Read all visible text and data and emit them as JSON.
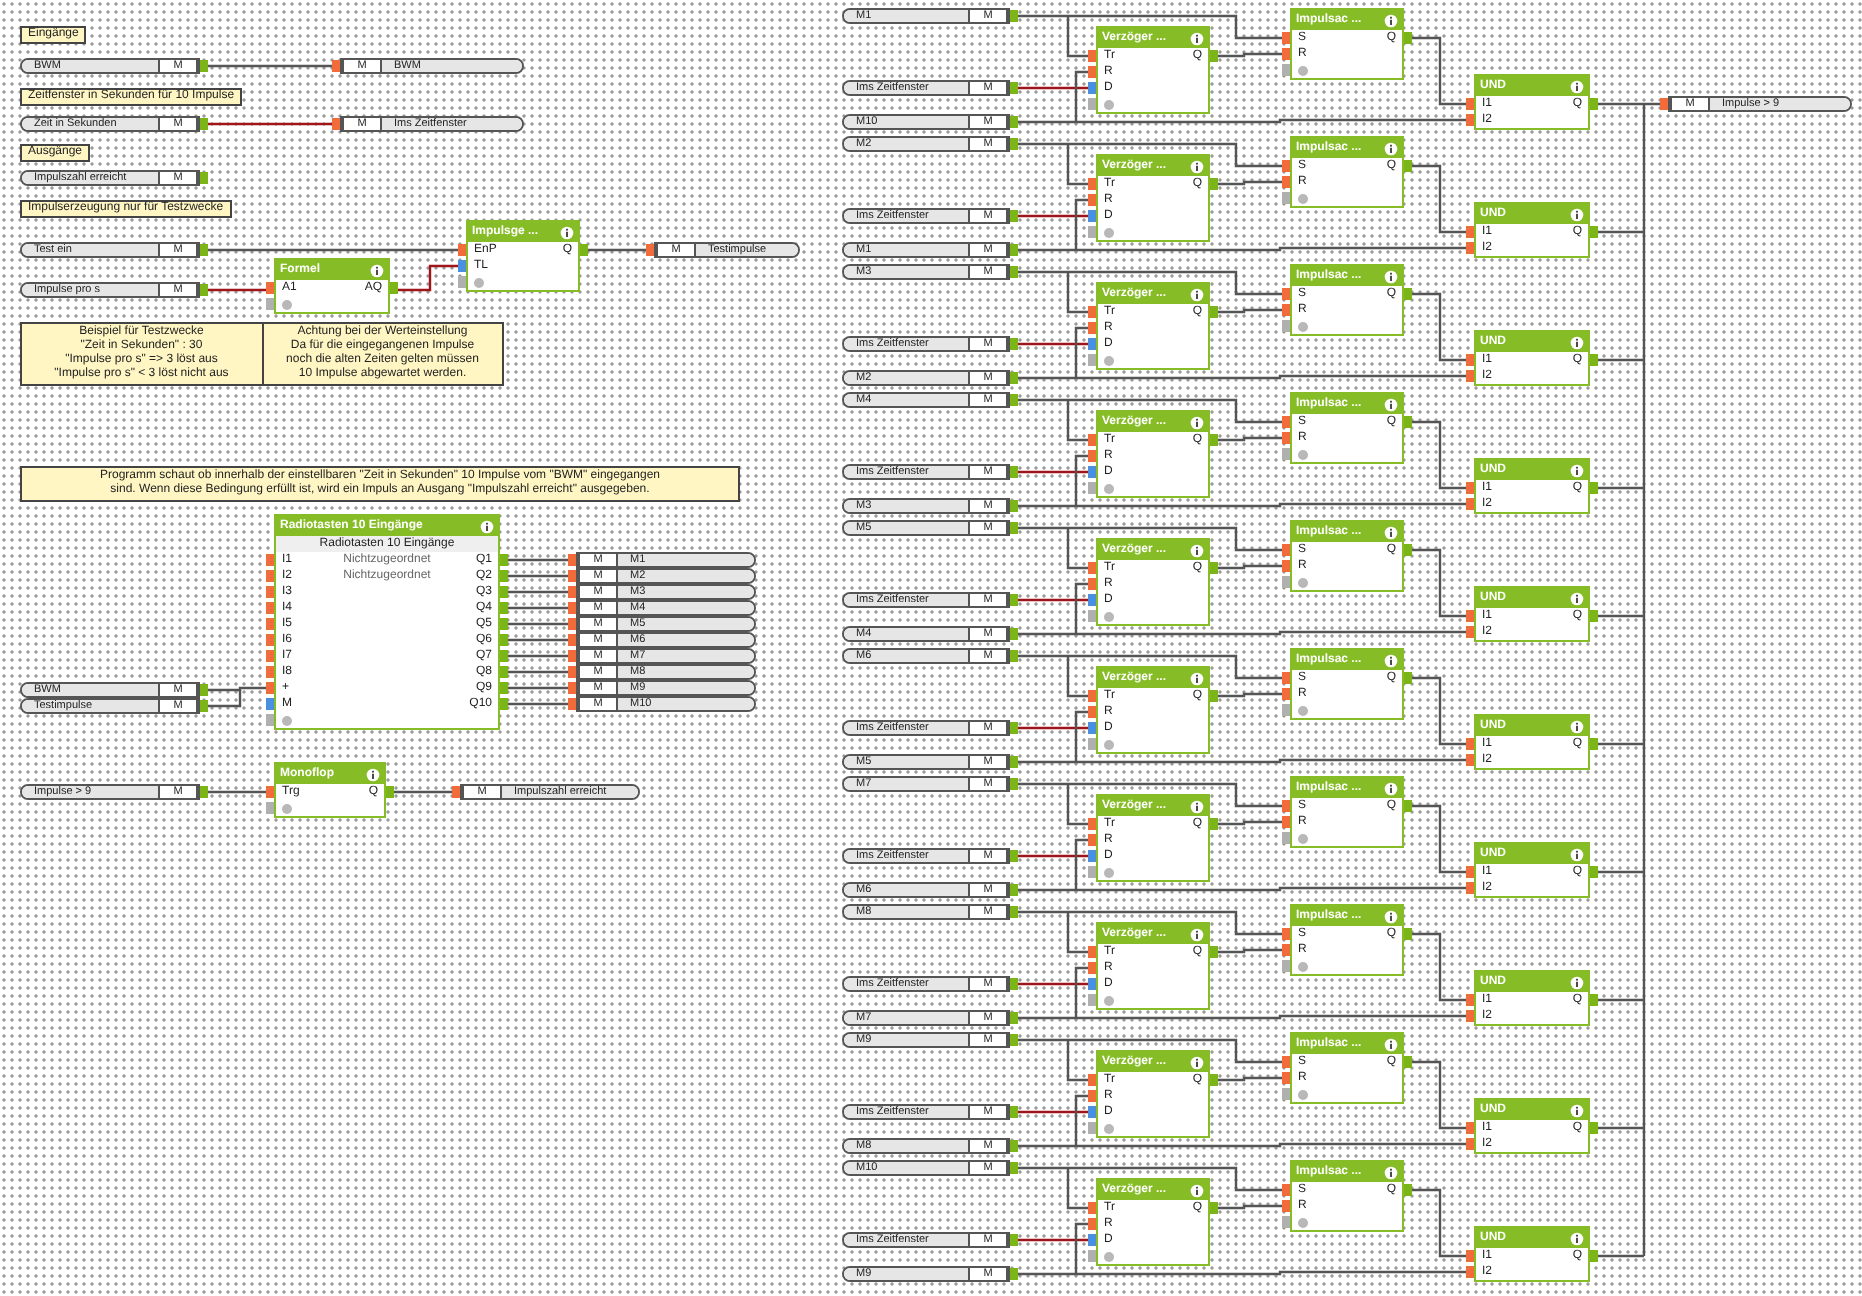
{
  "labels": [
    "Eingänge",
    "Zeitfenster in Sekunden für 10 Impulse",
    "Ausgänge",
    "Impulserzeugung nur für Testzwecke"
  ],
  "refs": [
    {
      "kind": "input",
      "name": "BWM",
      "tag": "M"
    },
    {
      "kind": "output",
      "name": "BWM",
      "tag": "M"
    },
    {
      "kind": "input",
      "name": "Zeit in Sekunden",
      "tag": "M"
    },
    {
      "kind": "output",
      "name": "Ims Zeitfenster",
      "tag": "M"
    },
    {
      "kind": "input",
      "name": "Impulszahl erreicht",
      "tag": "M"
    },
    {
      "kind": "input",
      "name": "Test ein",
      "tag": "M"
    },
    {
      "kind": "input",
      "name": "Impulse pro s",
      "tag": "M"
    },
    {
      "kind": "output",
      "name": "Testimpulse",
      "tag": "M"
    },
    {
      "kind": "input",
      "name": "BWM",
      "tag": "M"
    },
    {
      "kind": "input",
      "name": "Testimpulse",
      "tag": "M"
    },
    {
      "kind": "output",
      "name": "M1",
      "tag": "M"
    },
    {
      "kind": "output",
      "name": "M2",
      "tag": "M"
    },
    {
      "kind": "output",
      "name": "M3",
      "tag": "M"
    },
    {
      "kind": "output",
      "name": "M4",
      "tag": "M"
    },
    {
      "kind": "output",
      "name": "M5",
      "tag": "M"
    },
    {
      "kind": "output",
      "name": "M6",
      "tag": "M"
    },
    {
      "kind": "output",
      "name": "M7",
      "tag": "M"
    },
    {
      "kind": "output",
      "name": "M8",
      "tag": "M"
    },
    {
      "kind": "output",
      "name": "M9",
      "tag": "M"
    },
    {
      "kind": "output",
      "name": "M10",
      "tag": "M"
    },
    {
      "kind": "input",
      "name": "Impulse > 9",
      "tag": "M"
    },
    {
      "kind": "output",
      "name": "Impulszahl erreicht",
      "tag": "M"
    }
  ],
  "blocks": [
    {
      "status_row": true,
      "title": "Formel",
      "inputs": [
        {
          "label": "A1",
          "kind": "binary"
        }
      ],
      "outputs": [
        "AQ"
      ]
    },
    {
      "status_row": true,
      "title": "Impulsge ...",
      "inputs": [
        {
          "label": "EnP",
          "kind": "binary"
        },
        {
          "label": "TL",
          "kind": "value"
        }
      ],
      "outputs": [
        "Q"
      ]
    },
    {
      "status_row": true,
      "title": "Radiotasten 10 Eingänge",
      "subtitle": "Radiotasten 10 Eingänge",
      "notes": [
        "Nichtzugeordnet",
        "Nichtzugeordnet"
      ],
      "inputs": [
        {
          "label": "I1",
          "kind": "binary"
        },
        {
          "label": "I2",
          "kind": "binary"
        },
        {
          "label": "I3",
          "kind": "binary"
        },
        {
          "label": "I4",
          "kind": "binary"
        },
        {
          "label": "I5",
          "kind": "binary"
        },
        {
          "label": "I6",
          "kind": "binary"
        },
        {
          "label": "I7",
          "kind": "binary"
        },
        {
          "label": "I8",
          "kind": "binary"
        },
        {
          "label": "+",
          "kind": "binary"
        },
        {
          "label": "M",
          "kind": "value"
        }
      ],
      "outputs": [
        "Q1",
        "Q2",
        "Q3",
        "Q4",
        "Q5",
        "Q6",
        "Q7",
        "Q8",
        "Q9",
        "Q10"
      ]
    },
    {
      "status_row": true,
      "title": "Monoflop",
      "inputs": [
        {
          "label": "Trg",
          "kind": "binary"
        }
      ],
      "outputs": [
        "Q"
      ]
    }
  ],
  "notes": [
    {
      "columns": [
        [
          "Beispiel für Testzwecke",
          "\"Zeit in Sekunden\" : 30",
          "\"Impulse pro s\" => 3 löst aus",
          "\"Impulse pro s\" < 3 löst nicht aus"
        ],
        [
          "Achtung bei der Werteinstellung",
          "Da für die eingegangenen Impulse",
          "noch die alten Zeiten gelten müssen",
          "10 Impulse abgewartet werden."
        ]
      ]
    },
    {
      "columns": [
        [
          "Programm schaut ob innerhalb der einstellbaren \"Zeit in Sekunden\" 10 Impulse vom \"BWM\" eingegangen",
          "sind. Wenn diese Bedingung erfüllt ist, wird ein Impuls an Ausgang \"Impulszahl erreicht\" ausgegeben."
        ]
      ]
    }
  ],
  "chains": [
    {
      "trigger": {
        "kind": "input",
        "name": "M1",
        "tag": "M"
      },
      "window": {
        "kind": "input",
        "name": "Ims Zeitfenster",
        "tag": "M"
      },
      "reset": {
        "kind": "input",
        "name": "M10",
        "tag": "M"
      },
      "delay": {
        "status_row": true,
        "title": "Verzöger ...",
        "inputs": [
          {
            "label": "Tr",
            "kind": "binary"
          },
          {
            "label": "R",
            "kind": "binary"
          },
          {
            "label": "D",
            "kind": "value"
          }
        ],
        "outputs": [
          "Q"
        ]
      },
      "pulse": {
        "status_row": true,
        "title": "Impulsac ...",
        "inputs": [
          {
            "label": "S",
            "kind": "binary"
          },
          {
            "label": "R",
            "kind": "binary"
          }
        ],
        "outputs": [
          "Q"
        ]
      },
      "and": {
        "title": "UND",
        "inputs": [
          {
            "label": "I1",
            "kind": "binary"
          },
          {
            "label": "I2",
            "kind": "binary"
          }
        ],
        "outputs": [
          "Q"
        ]
      }
    },
    {
      "trigger": {
        "kind": "input",
        "name": "M2",
        "tag": "M"
      },
      "window": {
        "kind": "input",
        "name": "Ims Zeitfenster",
        "tag": "M"
      },
      "reset": {
        "kind": "input",
        "name": "M1",
        "tag": "M"
      },
      "delay": {
        "status_row": true,
        "title": "Verzöger ...",
        "inputs": [
          {
            "label": "Tr",
            "kind": "binary"
          },
          {
            "label": "R",
            "kind": "binary"
          },
          {
            "label": "D",
            "kind": "value"
          }
        ],
        "outputs": [
          "Q"
        ]
      },
      "pulse": {
        "status_row": true,
        "title": "Impulsac ...",
        "inputs": [
          {
            "label": "S",
            "kind": "binary"
          },
          {
            "label": "R",
            "kind": "binary"
          }
        ],
        "outputs": [
          "Q"
        ]
      },
      "and": {
        "title": "UND",
        "inputs": [
          {
            "label": "I1",
            "kind": "binary"
          },
          {
            "label": "I2",
            "kind": "binary"
          }
        ],
        "outputs": [
          "Q"
        ]
      }
    },
    {
      "trigger": {
        "kind": "input",
        "name": "M3",
        "tag": "M"
      },
      "window": {
        "kind": "input",
        "name": "Ims Zeitfenster",
        "tag": "M"
      },
      "reset": {
        "kind": "input",
        "name": "M2",
        "tag": "M"
      },
      "delay": {
        "status_row": true,
        "title": "Verzöger ...",
        "inputs": [
          {
            "label": "Tr",
            "kind": "binary"
          },
          {
            "label": "R",
            "kind": "binary"
          },
          {
            "label": "D",
            "kind": "value"
          }
        ],
        "outputs": [
          "Q"
        ]
      },
      "pulse": {
        "status_row": true,
        "title": "Impulsac ...",
        "inputs": [
          {
            "label": "S",
            "kind": "binary"
          },
          {
            "label": "R",
            "kind": "binary"
          }
        ],
        "outputs": [
          "Q"
        ]
      },
      "and": {
        "title": "UND",
        "inputs": [
          {
            "label": "I1",
            "kind": "binary"
          },
          {
            "label": "I2",
            "kind": "binary"
          }
        ],
        "outputs": [
          "Q"
        ]
      }
    },
    {
      "trigger": {
        "kind": "input",
        "name": "M4",
        "tag": "M"
      },
      "window": {
        "kind": "input",
        "name": "Ims Zeitfenster",
        "tag": "M"
      },
      "reset": {
        "kind": "input",
        "name": "M3",
        "tag": "M"
      },
      "delay": {
        "status_row": true,
        "title": "Verzöger ...",
        "inputs": [
          {
            "label": "Tr",
            "kind": "binary"
          },
          {
            "label": "R",
            "kind": "binary"
          },
          {
            "label": "D",
            "kind": "value"
          }
        ],
        "outputs": [
          "Q"
        ]
      },
      "pulse": {
        "status_row": true,
        "title": "Impulsac ...",
        "inputs": [
          {
            "label": "S",
            "kind": "binary"
          },
          {
            "label": "R",
            "kind": "binary"
          }
        ],
        "outputs": [
          "Q"
        ]
      },
      "and": {
        "title": "UND",
        "inputs": [
          {
            "label": "I1",
            "kind": "binary"
          },
          {
            "label": "I2",
            "kind": "binary"
          }
        ],
        "outputs": [
          "Q"
        ]
      }
    },
    {
      "trigger": {
        "kind": "input",
        "name": "M5",
        "tag": "M"
      },
      "window": {
        "kind": "input",
        "name": "Ims Zeitfenster",
        "tag": "M"
      },
      "reset": {
        "kind": "input",
        "name": "M4",
        "tag": "M"
      },
      "delay": {
        "status_row": true,
        "title": "Verzöger ...",
        "inputs": [
          {
            "label": "Tr",
            "kind": "binary"
          },
          {
            "label": "R",
            "kind": "binary"
          },
          {
            "label": "D",
            "kind": "value"
          }
        ],
        "outputs": [
          "Q"
        ]
      },
      "pulse": {
        "status_row": true,
        "title": "Impulsac ...",
        "inputs": [
          {
            "label": "S",
            "kind": "binary"
          },
          {
            "label": "R",
            "kind": "binary"
          }
        ],
        "outputs": [
          "Q"
        ]
      },
      "and": {
        "title": "UND",
        "inputs": [
          {
            "label": "I1",
            "kind": "binary"
          },
          {
            "label": "I2",
            "kind": "binary"
          }
        ],
        "outputs": [
          "Q"
        ]
      }
    },
    {
      "trigger": {
        "kind": "input",
        "name": "M6",
        "tag": "M"
      },
      "window": {
        "kind": "input",
        "name": "Ims Zeitfenster",
        "tag": "M"
      },
      "reset": {
        "kind": "input",
        "name": "M5",
        "tag": "M"
      },
      "delay": {
        "status_row": true,
        "title": "Verzöger ...",
        "inputs": [
          {
            "label": "Tr",
            "kind": "binary"
          },
          {
            "label": "R",
            "kind": "binary"
          },
          {
            "label": "D",
            "kind": "value"
          }
        ],
        "outputs": [
          "Q"
        ]
      },
      "pulse": {
        "status_row": true,
        "title": "Impulsac ...",
        "inputs": [
          {
            "label": "S",
            "kind": "binary"
          },
          {
            "label": "R",
            "kind": "binary"
          }
        ],
        "outputs": [
          "Q"
        ]
      },
      "and": {
        "title": "UND",
        "inputs": [
          {
            "label": "I1",
            "kind": "binary"
          },
          {
            "label": "I2",
            "kind": "binary"
          }
        ],
        "outputs": [
          "Q"
        ]
      }
    },
    {
      "trigger": {
        "kind": "input",
        "name": "M7",
        "tag": "M"
      },
      "window": {
        "kind": "input",
        "name": "Ims Zeitfenster",
        "tag": "M"
      },
      "reset": {
        "kind": "input",
        "name": "M6",
        "tag": "M"
      },
      "delay": {
        "status_row": true,
        "title": "Verzöger ...",
        "inputs": [
          {
            "label": "Tr",
            "kind": "binary"
          },
          {
            "label": "R",
            "kind": "binary"
          },
          {
            "label": "D",
            "kind": "value"
          }
        ],
        "outputs": [
          "Q"
        ]
      },
      "pulse": {
        "status_row": true,
        "title": "Impulsac ...",
        "inputs": [
          {
            "label": "S",
            "kind": "binary"
          },
          {
            "label": "R",
            "kind": "binary"
          }
        ],
        "outputs": [
          "Q"
        ]
      },
      "and": {
        "title": "UND",
        "inputs": [
          {
            "label": "I1",
            "kind": "binary"
          },
          {
            "label": "I2",
            "kind": "binary"
          }
        ],
        "outputs": [
          "Q"
        ]
      }
    },
    {
      "trigger": {
        "kind": "input",
        "name": "M8",
        "tag": "M"
      },
      "window": {
        "kind": "input",
        "name": "Ims Zeitfenster",
        "tag": "M"
      },
      "reset": {
        "kind": "input",
        "name": "M7",
        "tag": "M"
      },
      "delay": {
        "status_row": true,
        "title": "Verzöger ...",
        "inputs": [
          {
            "label": "Tr",
            "kind": "binary"
          },
          {
            "label": "R",
            "kind": "binary"
          },
          {
            "label": "D",
            "kind": "value"
          }
        ],
        "outputs": [
          "Q"
        ]
      },
      "pulse": {
        "status_row": true,
        "title": "Impulsac ...",
        "inputs": [
          {
            "label": "S",
            "kind": "binary"
          },
          {
            "label": "R",
            "kind": "binary"
          }
        ],
        "outputs": [
          "Q"
        ]
      },
      "and": {
        "title": "UND",
        "inputs": [
          {
            "label": "I1",
            "kind": "binary"
          },
          {
            "label": "I2",
            "kind": "binary"
          }
        ],
        "outputs": [
          "Q"
        ]
      }
    },
    {
      "trigger": {
        "kind": "input",
        "name": "M9",
        "tag": "M"
      },
      "window": {
        "kind": "input",
        "name": "Ims Zeitfenster",
        "tag": "M"
      },
      "reset": {
        "kind": "input",
        "name": "M8",
        "tag": "M"
      },
      "delay": {
        "status_row": true,
        "title": "Verzöger ...",
        "inputs": [
          {
            "label": "Tr",
            "kind": "binary"
          },
          {
            "label": "R",
            "kind": "binary"
          },
          {
            "label": "D",
            "kind": "value"
          }
        ],
        "outputs": [
          "Q"
        ]
      },
      "pulse": {
        "status_row": true,
        "title": "Impulsac ...",
        "inputs": [
          {
            "label": "S",
            "kind": "binary"
          },
          {
            "label": "R",
            "kind": "binary"
          }
        ],
        "outputs": [
          "Q"
        ]
      },
      "and": {
        "title": "UND",
        "inputs": [
          {
            "label": "I1",
            "kind": "binary"
          },
          {
            "label": "I2",
            "kind": "binary"
          }
        ],
        "outputs": [
          "Q"
        ]
      }
    },
    {
      "trigger": {
        "kind": "input",
        "name": "M10",
        "tag": "M"
      },
      "window": {
        "kind": "input",
        "name": "Ims Zeitfenster",
        "tag": "M"
      },
      "reset": {
        "kind": "input",
        "name": "M9",
        "tag": "M"
      },
      "delay": {
        "status_row": true,
        "title": "Verzöger ...",
        "inputs": [
          {
            "label": "Tr",
            "kind": "binary"
          },
          {
            "label": "R",
            "kind": "binary"
          },
          {
            "label": "D",
            "kind": "value"
          }
        ],
        "outputs": [
          "Q"
        ]
      },
      "pulse": {
        "status_row": true,
        "title": "Impulsac ...",
        "inputs": [
          {
            "label": "S",
            "kind": "binary"
          },
          {
            "label": "R",
            "kind": "binary"
          }
        ],
        "outputs": [
          "Q"
        ]
      },
      "and": {
        "title": "UND",
        "inputs": [
          {
            "label": "I1",
            "kind": "binary"
          },
          {
            "label": "I2",
            "kind": "binary"
          }
        ],
        "outputs": [
          "Q"
        ]
      }
    }
  ],
  "result": {
    "kind": "output",
    "name": "Impulse > 9",
    "tag": "M"
  }
}
